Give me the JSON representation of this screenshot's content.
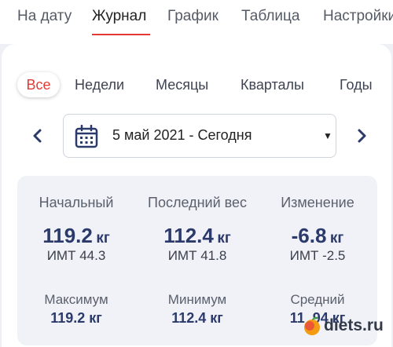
{
  "tabs": [
    "На дату",
    "Журнал",
    "График",
    "Таблица",
    "Настройки"
  ],
  "active_tab": "Журнал",
  "periods": [
    "Все",
    "Недели",
    "Месяцы",
    "Кварталы",
    "Годы"
  ],
  "active_period": "Все",
  "date_range": "5 май 2021 - Сегодня",
  "stats": {
    "start": {
      "label": "Начальный",
      "value": "119.2",
      "unit": "кг",
      "bmi": "ИМТ 44.3"
    },
    "last": {
      "label": "Последний вес",
      "value": "112.4",
      "unit": "кг",
      "bmi": "ИМТ 41.8"
    },
    "change": {
      "label": "Изменение",
      "value": "-6.8",
      "unit": "кг",
      "bmi": "ИМТ -2.5"
    },
    "max": {
      "label": "Максимум",
      "value": "119.2 кг"
    },
    "min": {
      "label": "Минимум",
      "value": "112.4 кг"
    },
    "avg": {
      "label": "Средний",
      "value": "11 .94 кг"
    }
  },
  "watermark": "diets.ru",
  "colors": {
    "accent": "#e53935",
    "value": "#2b3a6b",
    "panel": "#f0f2f7"
  }
}
